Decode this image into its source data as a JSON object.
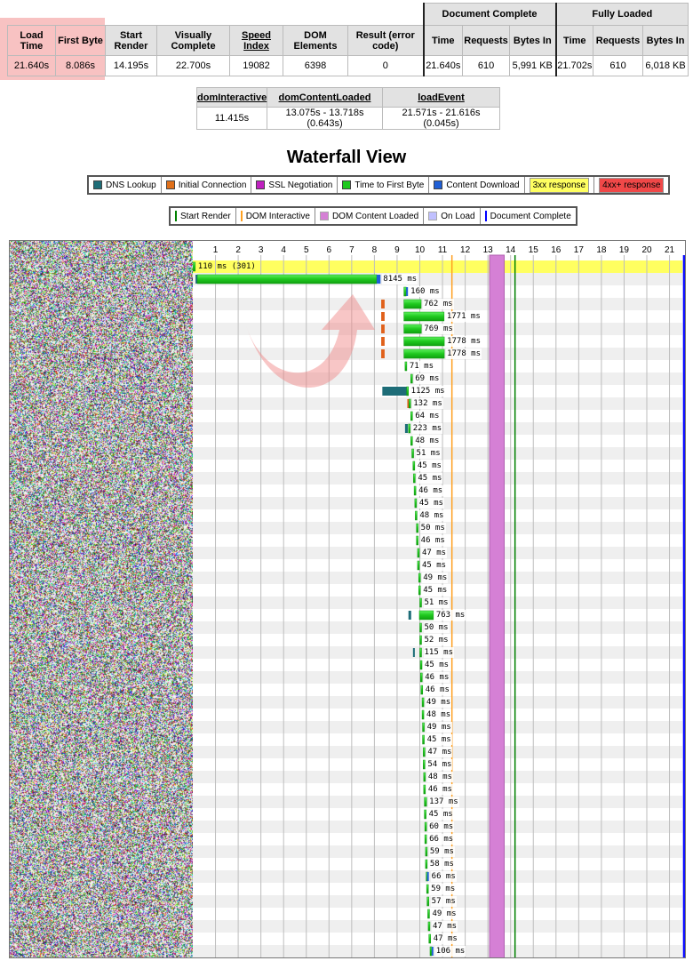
{
  "summary": {
    "headers": [
      "Load Time",
      "First Byte",
      "Start Render",
      "Visually Complete",
      "Speed Index",
      "DOM Elements",
      "Result (error code)"
    ],
    "values": [
      "21.640s",
      "8.086s",
      "14.195s",
      "22.700s",
      "19082",
      "6398",
      "0"
    ],
    "document_complete": {
      "title": "Document Complete",
      "headers": [
        "Time",
        "Requests",
        "Bytes In"
      ],
      "values": [
        "21.640s",
        "610",
        "5,991 KB"
      ]
    },
    "fully_loaded": {
      "title": "Fully Loaded",
      "headers": [
        "Time",
        "Requests",
        "Bytes In"
      ],
      "values": [
        "21.702s",
        "610",
        "6,018 KB"
      ]
    },
    "highlight_color": "#f08080"
  },
  "timings": {
    "headers": [
      "domInteractive",
      "domContentLoaded",
      "loadEvent"
    ],
    "values": [
      "11.415s",
      "13.075s - 13.718s (0.643s)",
      "21.571s - 21.616s (0.045s)"
    ]
  },
  "waterfall": {
    "title": "Waterfall View",
    "legend": [
      {
        "label": "DNS Lookup",
        "color": "#1e6d78"
      },
      {
        "label": "Initial Connection",
        "color": "#e0701a"
      },
      {
        "label": "SSL Negotiation",
        "color": "#c020c0"
      },
      {
        "label": "Time to First Byte",
        "color": "#1ec81e"
      },
      {
        "label": "Content Download",
        "color": "#1f5fd6"
      },
      {
        "label": "3xx response",
        "color": "#ffff60"
      },
      {
        "label": "4xx+ response",
        "color": "#f04848"
      }
    ],
    "events_legend": [
      {
        "label": "Start Render",
        "color": "#008000",
        "kind": "line"
      },
      {
        "label": "DOM Interactive",
        "color": "#ffa020",
        "kind": "line"
      },
      {
        "label": "DOM Content Loaded",
        "color": "#d580d5",
        "kind": "box"
      },
      {
        "label": "On Load",
        "color": "#c0c0ff",
        "kind": "box"
      },
      {
        "label": "Document Complete",
        "color": "#0000ff",
        "kind": "line"
      }
    ]
  },
  "chart_data": {
    "type": "bar",
    "x_unit": "seconds",
    "xlim": [
      0,
      21.75
    ],
    "ticks": [
      1,
      2,
      3,
      4,
      5,
      6,
      7,
      8,
      9,
      10,
      11,
      12,
      13,
      14,
      15,
      16,
      17,
      18,
      19,
      20,
      21
    ],
    "grid": true,
    "events": {
      "start_render": 14.195,
      "dom_interactive": 11.415,
      "dom_content_loaded": [
        13.075,
        13.718
      ],
      "on_load": [
        21.571,
        21.616
      ],
      "document_complete": 21.64
    },
    "requests": [
      {
        "ms": 110,
        "label": "110 ms (301)",
        "status": "3xx",
        "ttfb": [
          0.0,
          0.11
        ]
      },
      {
        "ms": 8145,
        "dns": [
          0.12,
          0.2
        ],
        "ttfb": [
          0.2,
          8.1
        ],
        "download": [
          8.1,
          8.27
        ]
      },
      {
        "ms": 160,
        "ttfb": [
          9.3,
          9.4
        ],
        "download": [
          9.4,
          9.46
        ]
      },
      {
        "ms": 762,
        "connect": [
          8.3,
          8.45
        ],
        "ttfb": [
          9.3,
          10.06
        ]
      },
      {
        "ms": 1771,
        "connect": [
          8.3,
          8.45
        ],
        "ttfb": [
          9.3,
          11.07
        ]
      },
      {
        "ms": 769,
        "connect": [
          8.3,
          8.45
        ],
        "ttfb": [
          9.3,
          10.07
        ]
      },
      {
        "ms": 1778,
        "connect": [
          8.3,
          8.45
        ],
        "ttfb": [
          9.3,
          11.08
        ]
      },
      {
        "ms": 1778,
        "connect": [
          8.3,
          8.45
        ],
        "ttfb": [
          9.3,
          11.08
        ]
      },
      {
        "ms": 71,
        "ttfb": [
          9.35,
          9.42
        ]
      },
      {
        "ms": 69,
        "ttfb": [
          9.6,
          9.67
        ]
      },
      {
        "ms": 1125,
        "dns": [
          8.35,
          9.42
        ],
        "ttfb": [
          9.42,
          9.475
        ]
      },
      {
        "ms": 132,
        "connect": [
          9.45,
          9.52
        ],
        "ttfb": [
          9.52,
          9.58
        ]
      },
      {
        "ms": 64,
        "ttfb": [
          9.6,
          9.66
        ]
      },
      {
        "ms": 223,
        "dns": [
          9.35,
          9.47
        ],
        "ttfb": [
          9.5,
          9.57
        ]
      },
      {
        "ms": 48,
        "ttfb": [
          9.6,
          9.65
        ]
      },
      {
        "ms": 51,
        "ttfb": [
          9.65,
          9.7
        ]
      },
      {
        "ms": 45,
        "ttfb": [
          9.7,
          9.75
        ]
      },
      {
        "ms": 45,
        "ttfb": [
          9.72,
          9.77
        ]
      },
      {
        "ms": 46,
        "ttfb": [
          9.75,
          9.8
        ]
      },
      {
        "ms": 45,
        "ttfb": [
          9.78,
          9.83
        ]
      },
      {
        "ms": 48,
        "ttfb": [
          9.8,
          9.85
        ]
      },
      {
        "ms": 50,
        "ttfb": [
          9.85,
          9.9
        ]
      },
      {
        "ms": 46,
        "ttfb": [
          9.85,
          9.9
        ]
      },
      {
        "ms": 47,
        "ttfb": [
          9.9,
          9.95
        ]
      },
      {
        "ms": 45,
        "ttfb": [
          9.9,
          9.95
        ]
      },
      {
        "ms": 49,
        "ttfb": [
          9.95,
          10.0
        ]
      },
      {
        "ms": 45,
        "ttfb": [
          9.95,
          10.0
        ]
      },
      {
        "ms": 51,
        "ttfb": [
          10.0,
          10.05
        ]
      },
      {
        "ms": 763,
        "dns": [
          9.5,
          9.62
        ],
        "ttfb": [
          9.98,
          10.6
        ]
      },
      {
        "ms": 50,
        "ttfb": [
          10.0,
          10.05
        ]
      },
      {
        "ms": 52,
        "ttfb": [
          10.0,
          10.05
        ]
      },
      {
        "ms": 115,
        "dns": [
          9.7,
          9.78
        ],
        "ttfb": [
          10.0,
          10.06
        ]
      },
      {
        "ms": 45,
        "ttfb": [
          10.02,
          10.07
        ]
      },
      {
        "ms": 46,
        "ttfb": [
          10.03,
          10.08
        ]
      },
      {
        "ms": 46,
        "ttfb": [
          10.05,
          10.1
        ]
      },
      {
        "ms": 49,
        "ttfb": [
          10.1,
          10.15
        ]
      },
      {
        "ms": 48,
        "ttfb": [
          10.1,
          10.15
        ]
      },
      {
        "ms": 49,
        "ttfb": [
          10.12,
          10.17
        ]
      },
      {
        "ms": 45,
        "ttfb": [
          10.12,
          10.17
        ]
      },
      {
        "ms": 47,
        "ttfb": [
          10.15,
          10.2
        ]
      },
      {
        "ms": 54,
        "ttfb": [
          10.15,
          10.2
        ]
      },
      {
        "ms": 48,
        "ttfb": [
          10.17,
          10.22
        ]
      },
      {
        "ms": 46,
        "ttfb": [
          10.17,
          10.22
        ]
      },
      {
        "ms": 137,
        "ttfb": [
          10.2,
          10.3
        ]
      },
      {
        "ms": 45,
        "ttfb": [
          10.2,
          10.25
        ]
      },
      {
        "ms": 60,
        "ttfb": [
          10.22,
          10.28
        ]
      },
      {
        "ms": 66,
        "ttfb": [
          10.22,
          10.28
        ]
      },
      {
        "ms": 59,
        "ttfb": [
          10.25,
          10.31
        ]
      },
      {
        "ms": 58,
        "ttfb": [
          10.25,
          10.31
        ]
      },
      {
        "ms": 66,
        "ttfb": [
          10.28,
          10.32
        ],
        "download": [
          10.32,
          10.34
        ]
      },
      {
        "ms": 59,
        "ttfb": [
          10.3,
          10.36
        ]
      },
      {
        "ms": 57,
        "ttfb": [
          10.32,
          10.38
        ]
      },
      {
        "ms": 49,
        "ttfb": [
          10.35,
          10.4
        ]
      },
      {
        "ms": 47,
        "ttfb": [
          10.37,
          10.42
        ]
      },
      {
        "ms": 47,
        "ttfb": [
          10.4,
          10.45
        ]
      },
      {
        "ms": 106,
        "ttfb": [
          10.45,
          10.52
        ],
        "download": [
          10.52,
          10.56
        ]
      }
    ]
  }
}
